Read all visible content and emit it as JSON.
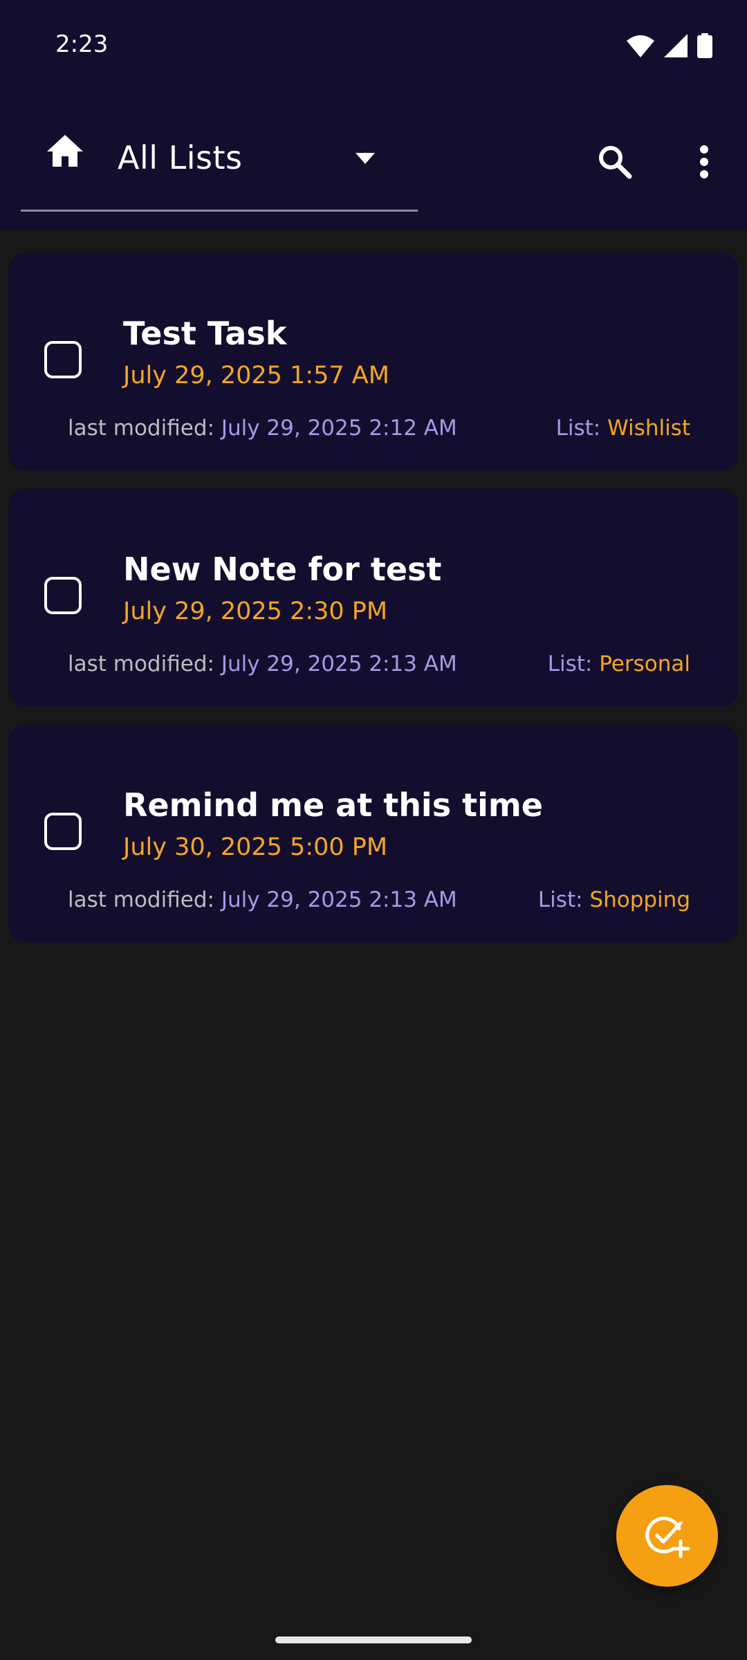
{
  "status_bar": {
    "time": "2:23",
    "icons": [
      "wifi-icon",
      "signal-icon",
      "battery-icon"
    ]
  },
  "appbar": {
    "list_selector": {
      "icon": "home-icon",
      "label": "All Lists",
      "dropdown_icon": "arrow-drop-down-icon"
    },
    "actions": [
      "search-icon",
      "more-vert-icon"
    ]
  },
  "tasks": [
    {
      "title": "Test Task",
      "due": "July 29, 2025 1:57 AM",
      "modified_label": "last modified:",
      "modified_value": "July 29, 2025 2:12 AM",
      "list_label": "List:",
      "list_name": "Wishlist",
      "checked": false
    },
    {
      "title": "New Note for test",
      "due": "July 29, 2025 2:30 PM",
      "modified_label": "last modified:",
      "modified_value": "July 29, 2025 2:13 AM",
      "list_label": "List:",
      "list_name": "Personal",
      "checked": false
    },
    {
      "title": "Remind me at this time",
      "due": "July 30, 2025 5:00 PM",
      "modified_label": "last modified:",
      "modified_value": "July 29, 2025 2:13 AM",
      "list_label": "List:",
      "list_name": "Shopping",
      "checked": false
    }
  ],
  "fab": {
    "icon": "add-task-icon"
  },
  "colors": {
    "background": "#181818",
    "surface": "#130e2e",
    "accent": "#f5a623",
    "secondary_text": "#a59ae6"
  }
}
